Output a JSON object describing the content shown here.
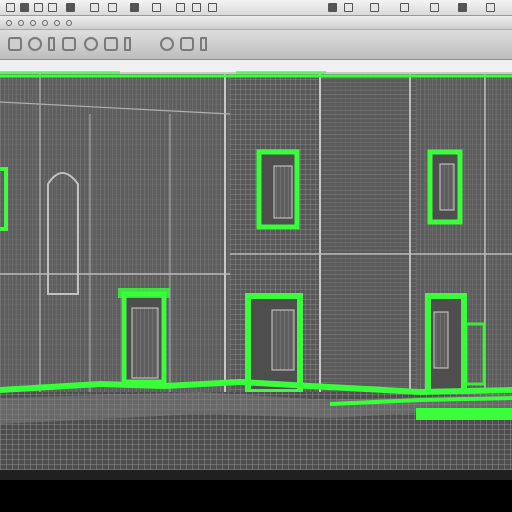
{
  "window": {
    "title": ""
  },
  "toolbar_icons": [
    "file-icon",
    "save-icon",
    "undo-icon",
    "redo-icon",
    "select-icon",
    "move-icon",
    "rotate-icon",
    "scale-icon",
    "render-icon",
    "layers-icon"
  ],
  "ribbon_icons": [
    "box-icon",
    "sphere-icon",
    "cylinder-icon",
    "plane-icon",
    "light-icon",
    "camera-icon",
    "modifier-icon",
    "material-icon"
  ],
  "viewport": {
    "mode": "wireframe",
    "selection_color": "#39ff3a",
    "wire_color": "#a9a9a9",
    "background": "#5b5b5b"
  },
  "colors": {
    "chrome_light": "#f4f4f4",
    "chrome_dark": "#bdbdbd",
    "bottom": "#000000"
  }
}
